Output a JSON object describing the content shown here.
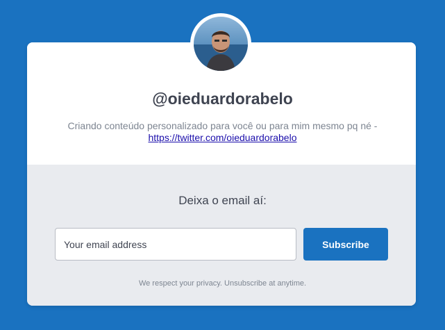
{
  "profile": {
    "username": "@oieduardorabelo",
    "bio_text": "Criando conteúdo personalizado para você ou para mim mesmo pq né -",
    "bio_link": "https://twitter.com/oieduardorabelo",
    "avatar_icon": "avatar-photo"
  },
  "form": {
    "cta_text": "Deixa o email aí:",
    "email_placeholder": "Your email address",
    "subscribe_label": "Subscribe",
    "privacy_text": "We respect your privacy. Unsubscribe at anytime."
  },
  "colors": {
    "background": "#1a72c0",
    "button": "#1a72c0",
    "card_bottom": "#e9ebef",
    "text": "#3f4451",
    "muted_text": "#7d8591"
  }
}
